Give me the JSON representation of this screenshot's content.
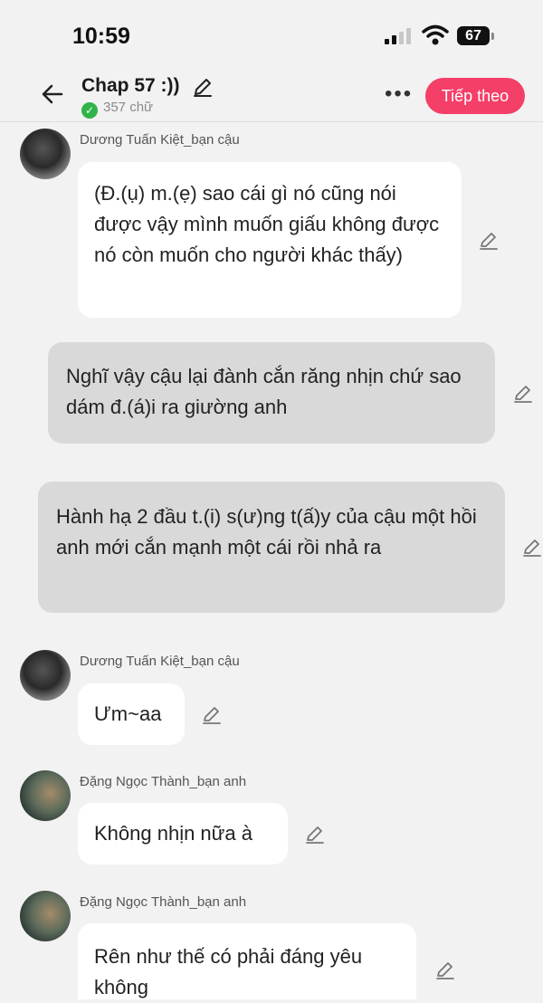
{
  "status_bar": {
    "time": "10:59",
    "battery": "67"
  },
  "header": {
    "title": "Chap 57 :))",
    "word_count": "357 chữ",
    "next_label": "Tiếp theo"
  },
  "messages": [
    {
      "sender": "Dương Tuấn Kiệt_bạn cậu",
      "text": "(Đ.(ụ) m.(ẹ) sao cái gì nó cũng nói được vậy mình muốn giấu không được nó còn muốn cho người khác thấy)"
    },
    {
      "sender": "",
      "text": "Nghĩ vậy cậu lại đành cắn răng nhịn chứ sao dám đ.(á)i ra giường anh"
    },
    {
      "sender": "",
      "text": "Hành hạ 2 đầu t.(i) s(ư)ng t(ấ)y của cậu một hồi anh mới cắn mạnh một cái rồi nhả ra"
    },
    {
      "sender": "Dương Tuấn Kiệt_bạn cậu",
      "text": "Ưm~aa"
    },
    {
      "sender": "Đặng Ngọc Thành_bạn anh",
      "text": "Không nhịn nữa à"
    },
    {
      "sender": "Đặng Ngọc Thành_bạn anh",
      "text": "Rên như thế có phải đáng yêu không"
    }
  ]
}
